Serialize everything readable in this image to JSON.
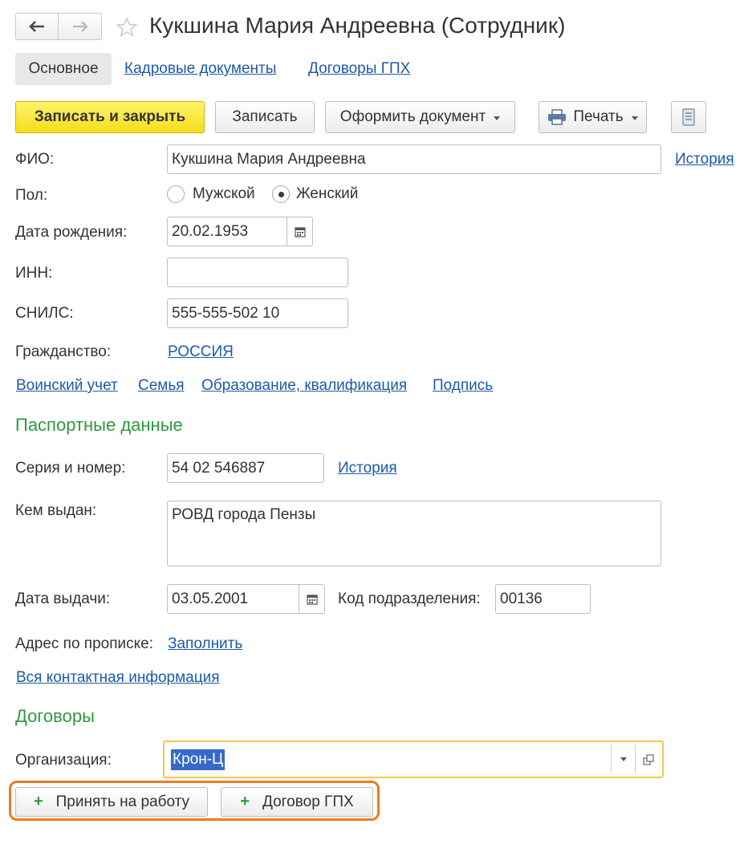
{
  "header": {
    "title": "Кукшина Мария Андреевна (Сотрудник)"
  },
  "tabs": [
    {
      "label": "Основное",
      "active": true
    },
    {
      "label": "Кадровые документы",
      "active": false
    },
    {
      "label": "Договоры ГПХ",
      "active": false
    }
  ],
  "toolbar": {
    "save_close": "Записать и закрыть",
    "save": "Записать",
    "create_doc": "Оформить документ",
    "print": "Печать"
  },
  "form": {
    "fio_label": "ФИО:",
    "fio_value": "Кукшина Мария Андреевна",
    "fio_history": "История",
    "gender_label": "Пол:",
    "gender_male": "Мужской",
    "gender_female": "Женский",
    "gender_selected": "Женский",
    "birth_label": "Дата рождения:",
    "birth_value": "20.02.1953",
    "inn_label": "ИНН:",
    "inn_value": "",
    "snils_label": "СНИЛС:",
    "snils_value": "555-555-502 10",
    "citizenship_label": "Гражданство:",
    "citizenship_value": "РОССИЯ"
  },
  "sublinks": [
    "Воинский учет",
    "Семья",
    "Образование, квалификация",
    "Подпись"
  ],
  "passport": {
    "heading": "Паспортные данные",
    "series_label": "Серия и номер:",
    "series_value": "54 02 546887",
    "series_history": "История",
    "issued_by_label": "Кем выдан:",
    "issued_by_value": "РОВД города Пензы",
    "issue_date_label": "Дата выдачи:",
    "issue_date_value": "03.05.2001",
    "dept_code_label": "Код подразделения:",
    "dept_code_value": "00136",
    "address_label": "Адрес по прописке:",
    "address_fill": "Заполнить",
    "all_contacts": "Вся контактная информация"
  },
  "contracts": {
    "heading": "Договоры",
    "org_label": "Организация:",
    "org_value": "Крон-Ц",
    "hire_button": "Принять на работу",
    "gph_button": "Договор ГПХ"
  },
  "colors": {
    "accent_green": "#2e9a3f",
    "link_blue": "#1e5aa8",
    "primary_yellow": "#f5dd1b",
    "highlight_orange": "#f07a1e",
    "focus_yellow": "#f2c94c"
  }
}
